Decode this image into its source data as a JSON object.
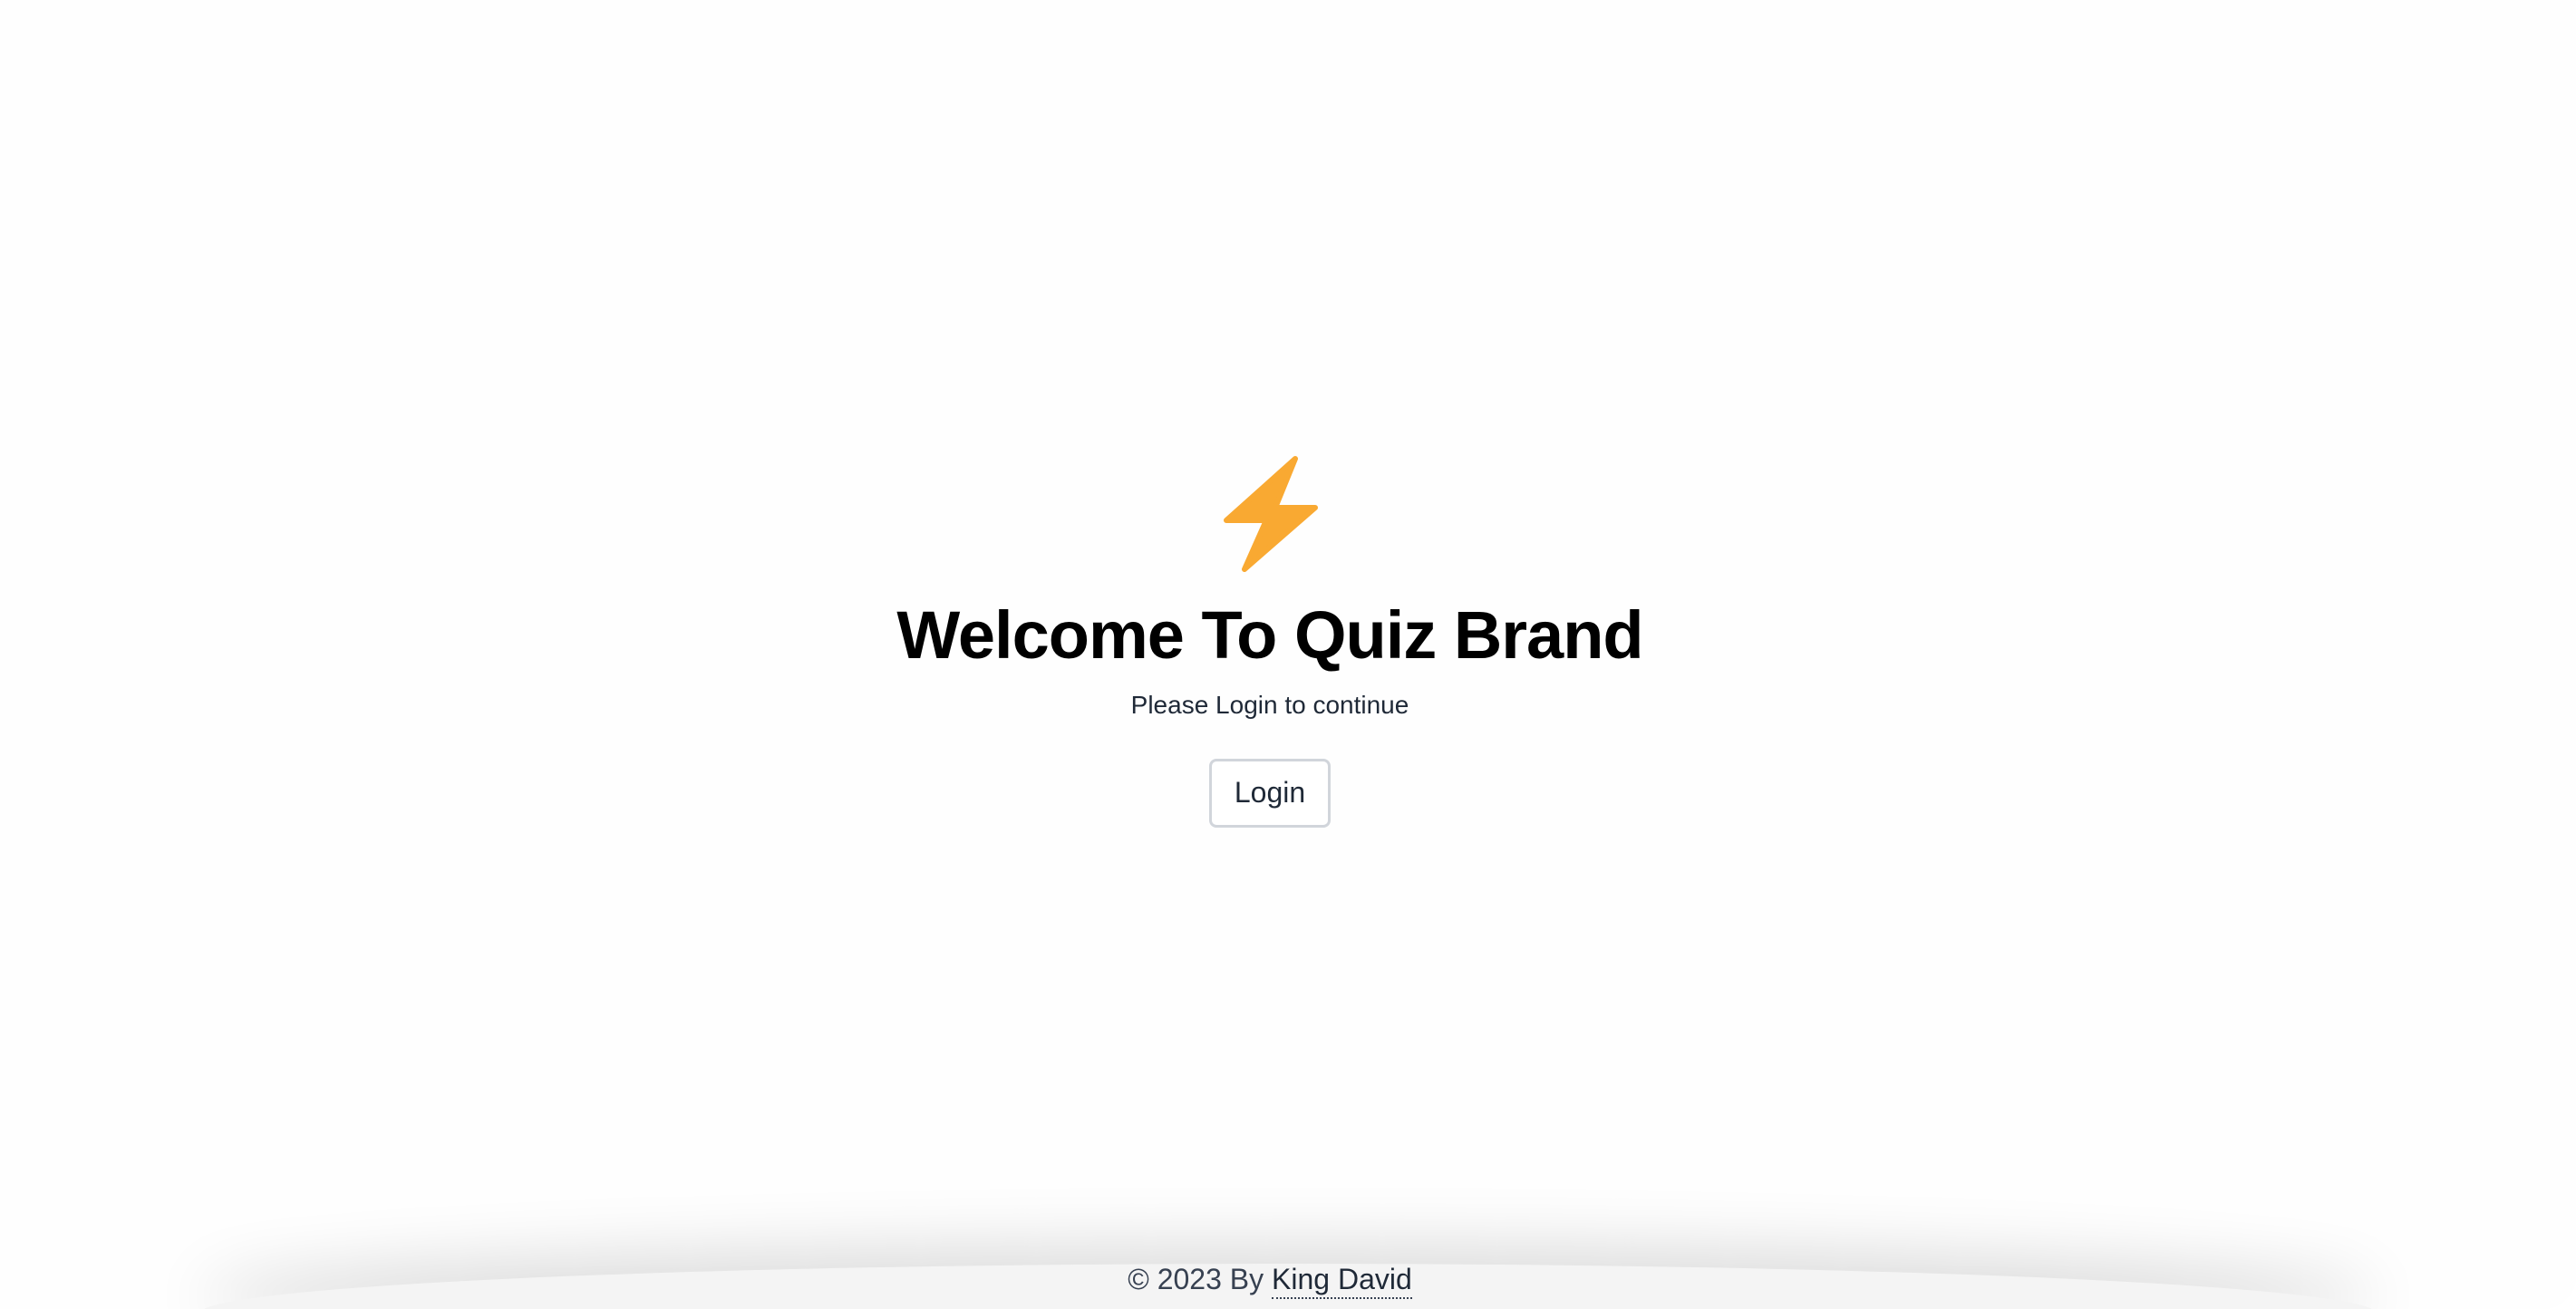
{
  "hero": {
    "icon": "lightning-bolt-icon",
    "icon_color": "#F9A932",
    "title": "Welcome To Quiz Brand",
    "subtitle": "Please Login to continue",
    "login_label": "Login"
  },
  "footer": {
    "copyright": "© 2023 By",
    "author": "King David"
  }
}
